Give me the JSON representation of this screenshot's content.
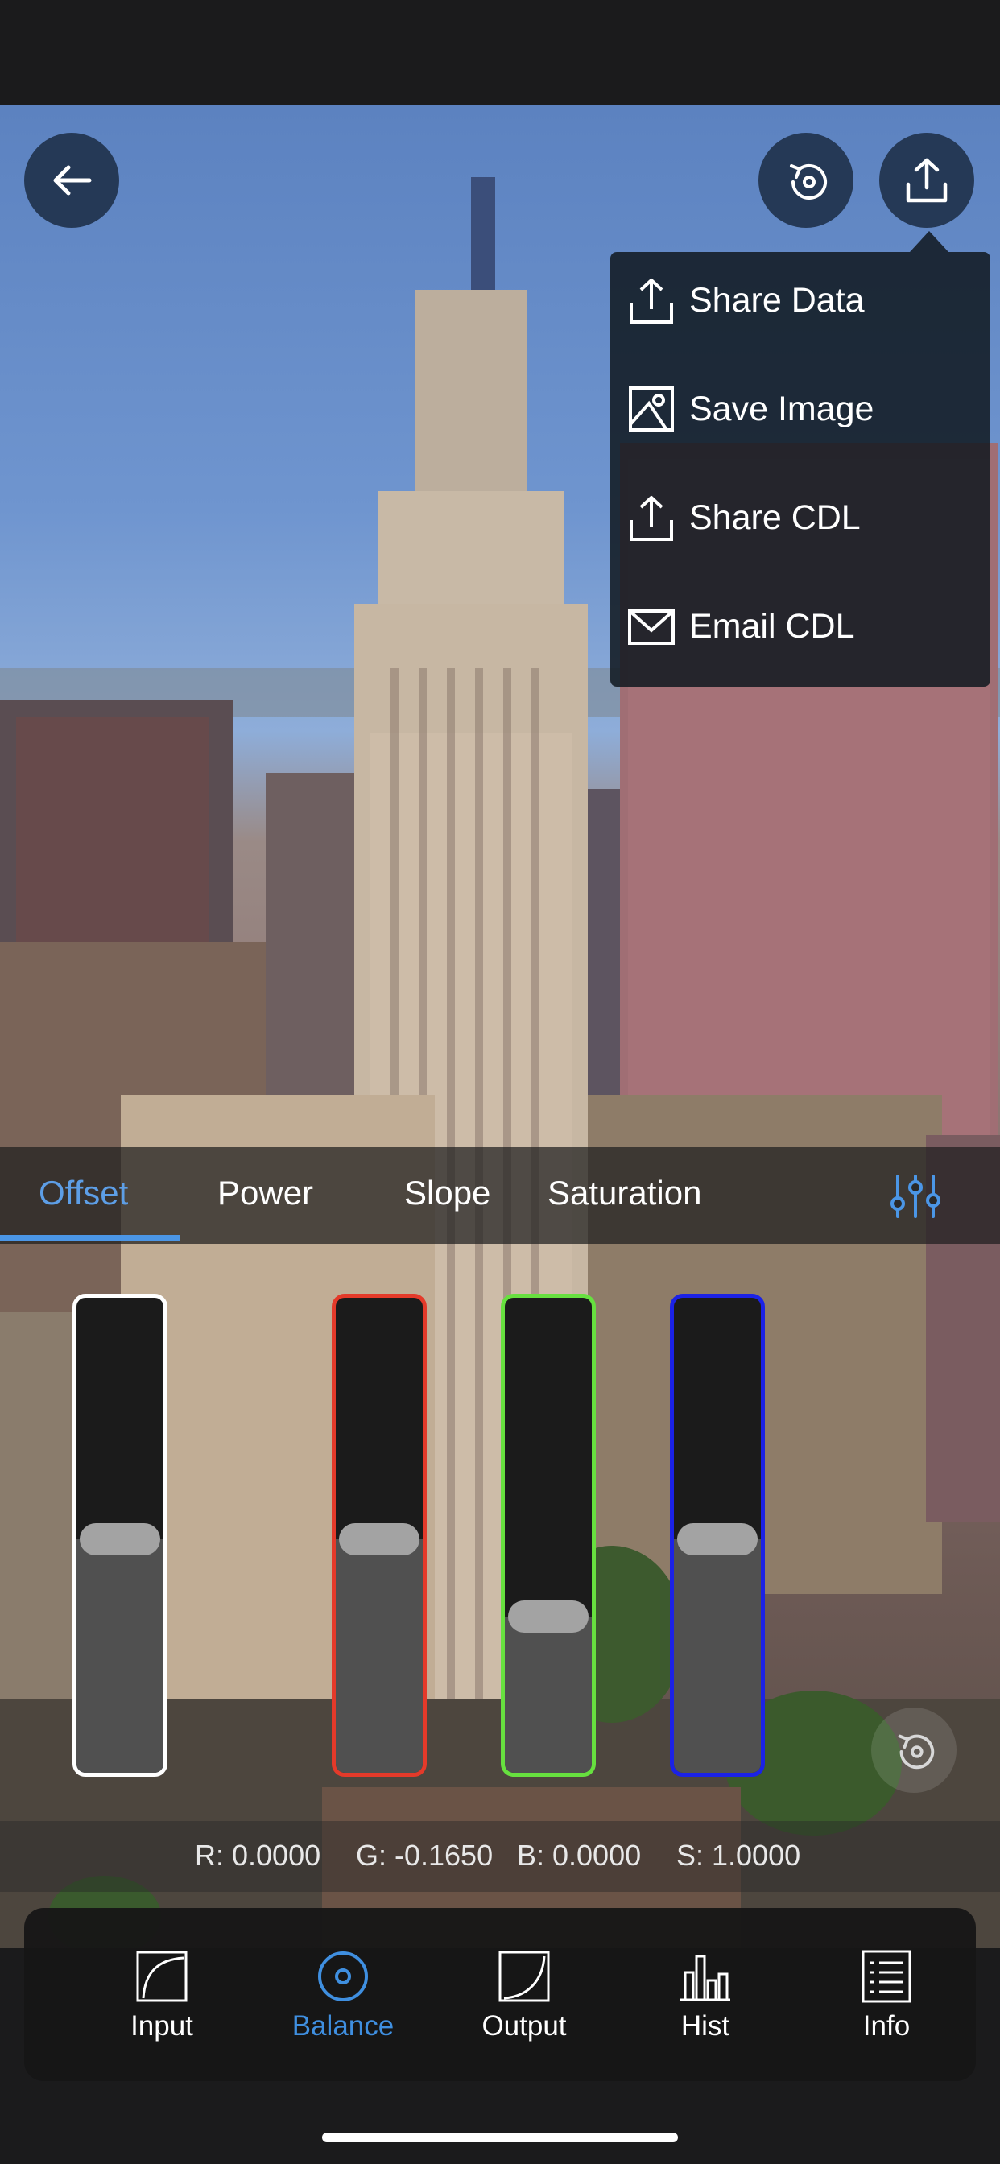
{
  "share_menu": {
    "items": [
      {
        "label": "Share Data",
        "icon": "share-data-icon"
      },
      {
        "label": "Save Image",
        "icon": "save-image-icon"
      },
      {
        "label": "Share CDL",
        "icon": "share-cdl-icon"
      },
      {
        "label": "Email CDL",
        "icon": "email-cdl-icon"
      }
    ]
  },
  "tabs": {
    "items": [
      "Offset",
      "Power",
      "Slope",
      "Saturation"
    ],
    "active": "Offset"
  },
  "sliders": [
    {
      "channel": "luma",
      "border_color": "#ffffff",
      "level": 0.5
    },
    {
      "channel": "red",
      "border_color": "#e43a2a",
      "level": 0.5
    },
    {
      "channel": "green",
      "border_color": "#67e03f",
      "level": 0.335
    },
    {
      "channel": "blue",
      "border_color": "#1b22e6",
      "level": 0.5
    }
  ],
  "readout": {
    "r": "R: 0.0000",
    "g": "G: -0.1650",
    "b": "B: 0.0000",
    "s": "S: 1.0000"
  },
  "toolbar": {
    "items": [
      {
        "label": "Input",
        "icon": "input-curve-icon"
      },
      {
        "label": "Balance",
        "icon": "balance-target-icon"
      },
      {
        "label": "Output",
        "icon": "output-curve-icon"
      },
      {
        "label": "Hist",
        "icon": "histogram-icon"
      },
      {
        "label": "Info",
        "icon": "info-list-icon"
      }
    ],
    "active": "Balance"
  },
  "colors": {
    "accent": "#4b96e6",
    "toolbar_active": "#3f8fe0"
  }
}
